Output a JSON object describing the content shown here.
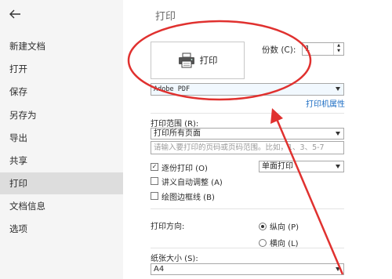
{
  "sidebar": {
    "back_icon": "arrow-left-icon",
    "items": [
      {
        "label": "新建文档"
      },
      {
        "label": "打开"
      },
      {
        "label": "保存"
      },
      {
        "label": "另存为"
      },
      {
        "label": "导出"
      },
      {
        "label": "共享"
      },
      {
        "label": "打印"
      },
      {
        "label": "文档信息"
      },
      {
        "label": "选项"
      }
    ],
    "active_item": "打印"
  },
  "main": {
    "title": "打印",
    "print_button": {
      "label": "打印",
      "icon": "printer-icon"
    },
    "copies": {
      "label": "份数 (C):",
      "value": "1"
    },
    "printer": {
      "selected": "Adobe PDF",
      "properties_link": "打印机属性"
    },
    "range": {
      "label": "打印范围 (R):",
      "selected": "打印所有页面",
      "pages_placeholder": "请输入要打印的页码或页码范围。比如，1、3、5-7"
    },
    "collate": {
      "label": "逐份打印 (O)",
      "checked": true
    },
    "sides": {
      "selected": "单面打印"
    },
    "auto_adjust": {
      "label": "讲义自动调整 (A)",
      "checked": false
    },
    "draw_border": {
      "label": "绘图边框线 (B)",
      "checked": false
    },
    "orientation": {
      "label": "打印方向:",
      "portrait": "纵向 (P)",
      "landscape": "横向 (L)",
      "selected": "portrait"
    },
    "paper_size": {
      "label": "纸张大小 (S):",
      "selected": "A4"
    }
  },
  "annotation_color": "#e0312f"
}
